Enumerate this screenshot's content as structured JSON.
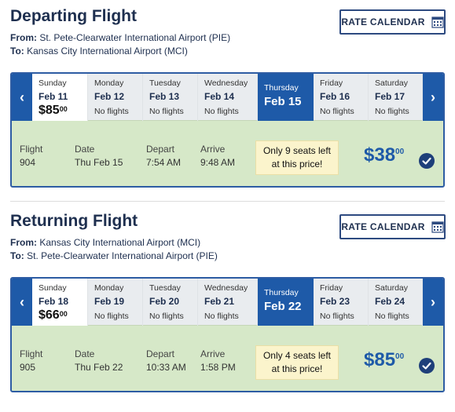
{
  "departing": {
    "title": "Departing Flight",
    "from_label": "From:",
    "from": "St. Pete-Clearwater International Airport (PIE)",
    "to_label": "To:",
    "to": "Kansas City International Airport (MCI)",
    "rate_calendar": "RATE CALENDAR",
    "days": [
      {
        "dow": "Sunday",
        "date": "Feb 11",
        "price": "$85",
        "cents": "00"
      },
      {
        "dow": "Monday",
        "date": "Feb 12",
        "status": "No flights"
      },
      {
        "dow": "Tuesday",
        "date": "Feb 13",
        "status": "No flights"
      },
      {
        "dow": "Wednesday",
        "date": "Feb 14",
        "status": "No flights"
      },
      {
        "dow": "Thursday",
        "date": "Feb 15"
      },
      {
        "dow": "Friday",
        "date": "Feb 16",
        "status": "No flights"
      },
      {
        "dow": "Saturday",
        "date": "Feb 17",
        "status": "No flights"
      }
    ],
    "flight": {
      "flight_label": "Flight",
      "flight": "904",
      "date_label": "Date",
      "date": "Thu Feb 15",
      "depart_label": "Depart",
      "depart": "7:54 AM",
      "arrive_label": "Arrive",
      "arrive": "9:48 AM",
      "seats_line1": "Only 9 seats left",
      "seats_line2": "at this price!",
      "fare": "$38",
      "fare_cents": "00"
    }
  },
  "returning": {
    "title": "Returning Flight",
    "from_label": "From:",
    "from": "Kansas City International Airport (MCI)",
    "to_label": "To:",
    "to": "St. Pete-Clearwater International Airport (PIE)",
    "rate_calendar": "RATE CALENDAR",
    "days": [
      {
        "dow": "Sunday",
        "date": "Feb 18",
        "price": "$66",
        "cents": "00"
      },
      {
        "dow": "Monday",
        "date": "Feb 19",
        "status": "No flights"
      },
      {
        "dow": "Tuesday",
        "date": "Feb 20",
        "status": "No flights"
      },
      {
        "dow": "Wednesday",
        "date": "Feb 21",
        "status": "No flights"
      },
      {
        "dow": "Thursday",
        "date": "Feb 22"
      },
      {
        "dow": "Friday",
        "date": "Feb 23",
        "status": "No flights"
      },
      {
        "dow": "Saturday",
        "date": "Feb 24",
        "status": "No flights"
      }
    ],
    "flight": {
      "flight_label": "Flight",
      "flight": "905",
      "date_label": "Date",
      "date": "Thu Feb 22",
      "depart_label": "Depart",
      "depart": "10:33 AM",
      "arrive_label": "Arrive",
      "arrive": "1:58 PM",
      "seats_line1": "Only 4 seats left",
      "seats_line2": "at this price!",
      "fare": "$85",
      "fare_cents": "00"
    }
  },
  "icons": {
    "prev": "‹",
    "next": "›",
    "calendar": "calendar-icon",
    "check": "check-circle-icon"
  },
  "colors": {
    "brand_blue": "#1e5aa8",
    "title_navy": "#1e2f4f",
    "flight_bg": "#d6e8c8",
    "seats_bg": "#fbf4cc"
  }
}
